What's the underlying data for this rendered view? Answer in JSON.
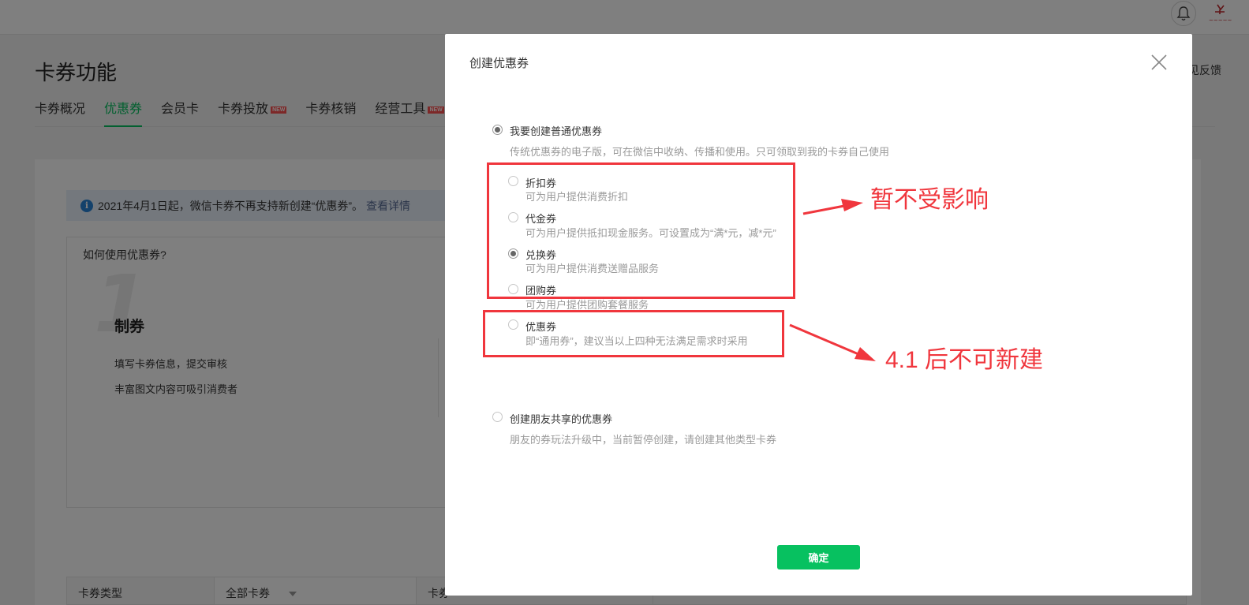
{
  "header": {
    "bell_icon": "bell-icon",
    "avatar_icon": "user-avatar"
  },
  "page": {
    "title": "卡券功能",
    "feedback": "见反馈",
    "tabs": [
      {
        "label": "卡券概况",
        "active": false,
        "new": false
      },
      {
        "label": "优惠券",
        "active": true,
        "new": false
      },
      {
        "label": "会员卡",
        "active": false,
        "new": false
      },
      {
        "label": "卡券投放",
        "active": false,
        "new": true
      },
      {
        "label": "卡券核销",
        "active": false,
        "new": false
      },
      {
        "label": "经营工具",
        "active": false,
        "new": true
      }
    ],
    "new_badge": "NEW",
    "notice": {
      "text": "2021年4月1日起，微信卡券不再支持新创建“优惠券”。",
      "link": "查看详情"
    },
    "howto": {
      "title": "如何使用优惠券?",
      "step_number": "1",
      "step_title": "制券",
      "step_lines": [
        "填写卡券信息，提交审核",
        "丰富图文内容可吸引消费者"
      ]
    },
    "filter": {
      "type_label": "卡券类型",
      "type_value": "全部卡券",
      "col3": "卡券",
      "col4": "",
      "col5": ""
    }
  },
  "dialog": {
    "title": "创建优惠券",
    "close_icon": "close-icon",
    "normal": {
      "label": "我要创建普通优惠券",
      "desc": "传统优惠券的电子版，可在微信中收纳、传播和使用。只可领取到我的卡券自己使用",
      "checked": true
    },
    "options": [
      {
        "label": "折扣券",
        "desc": "可为用户提供消费折扣",
        "checked": false
      },
      {
        "label": "代金券",
        "desc": "可为用户提供抵扣现金服务。可设置成为“满*元，减*元”",
        "checked": false
      },
      {
        "label": "兑换券",
        "desc": "可为用户提供消费送赠品服务",
        "checked": true
      },
      {
        "label": "团购券",
        "desc": "可为用户提供团购套餐服务",
        "checked": false
      },
      {
        "label": "优惠券",
        "desc": "即“通用券”，建议当以上四种无法满足需求时采用",
        "checked": false
      }
    ],
    "friend": {
      "label": "创建朋友共享的优惠券",
      "desc": "朋友的券玩法升级中，当前暂停创建，请创建其他类型卡券",
      "checked": false
    },
    "confirm_label": "确定"
  },
  "annotations": {
    "unaffected": "暂不受影响",
    "no_new": "4.1 后不可新建",
    "color": "#f0363d"
  },
  "colors": {
    "brand_green": "#07c160",
    "link_blue": "#576b95",
    "info_blue": "#2782d7"
  }
}
